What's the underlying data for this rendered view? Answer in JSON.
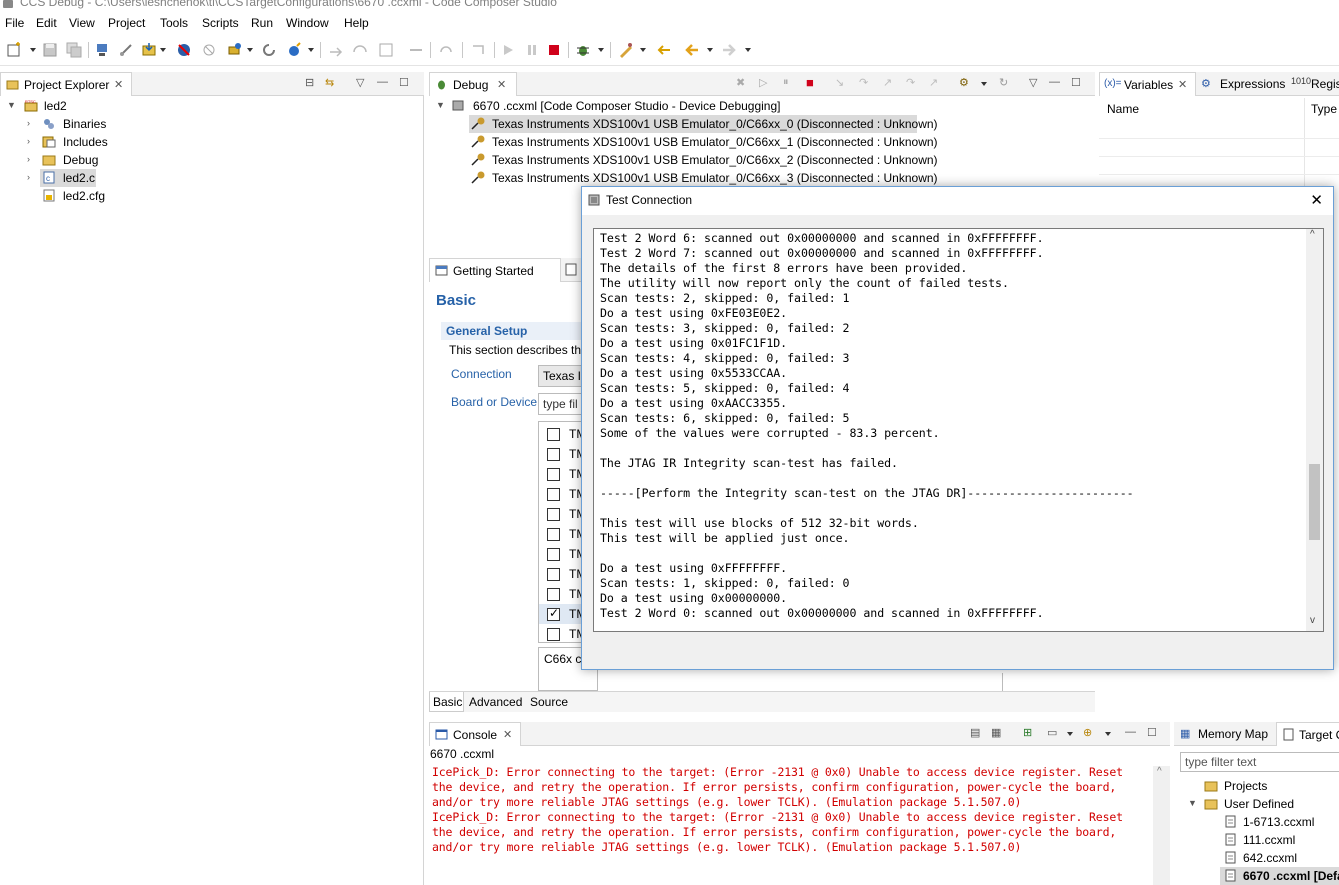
{
  "window": {
    "title": "CCS Debug - C:\\Users\\leshchenok\\ti\\CCSTargetConfigurations\\6670 .ccxml - Code Composer Studio"
  },
  "menu": [
    "File",
    "Edit",
    "View",
    "Project",
    "Tools",
    "Scripts",
    "Run",
    "Window",
    "Help"
  ],
  "project_explorer": {
    "tab_label": "Project Explorer",
    "project": "led2",
    "items": [
      "Binaries",
      "Includes",
      "Debug",
      "led2.c",
      "led2.cfg"
    ]
  },
  "debug_view": {
    "tab_label": "Debug",
    "session": "6670 .ccxml [Code Composer Studio - Device Debugging]",
    "cores": [
      "Texas Instruments XDS100v1 USB Emulator_0/C66xx_0 (Disconnected : Unknown)",
      "Texas Instruments XDS100v1 USB Emulator_0/C66xx_1 (Disconnected : Unknown)",
      "Texas Instruments XDS100v1 USB Emulator_0/C66xx_2 (Disconnected : Unknown)",
      "Texas Instruments XDS100v1 USB Emulator_0/C66xx_3 (Disconnected : Unknown)"
    ]
  },
  "variables_view": {
    "tabs": [
      "Variables",
      "Expressions",
      "Regist"
    ],
    "columns": [
      "Name",
      "Type"
    ]
  },
  "getting_started": {
    "tab_label": "Getting Started",
    "heading": "Basic",
    "section_title": "General Setup",
    "section_desc": "This section describes the",
    "connection_label": "Connection",
    "connection_value": "Texas In",
    "board_label": "Board or Device",
    "filter_placeholder": "type fil",
    "devices": [
      "TM",
      "TM",
      "TM",
      "TM",
      "TM",
      "TM",
      "TM",
      "TM",
      "TM",
      "TM",
      "TM"
    ],
    "checked_index": 9,
    "description_box": "C66x co",
    "bottom_tabs": [
      "Basic",
      "Advanced",
      "Source"
    ]
  },
  "console": {
    "tab_label": "Console",
    "config_name": "6670 .ccxml",
    "lines": [
      "IcePick_D: Error connecting to the target: (Error -2131 @ 0x0) Unable to access device register. Reset",
      "the device, and retry the operation. If error persists, confirm configuration, power-cycle the board,",
      "and/or try more reliable JTAG settings (e.g. lower TCLK). (Emulation package 5.1.507.0)",
      "IcePick_D: Error connecting to the target: (Error -2131 @ 0x0) Unable to access device register. Reset",
      "the device, and retry the operation. If error persists, confirm configuration, power-cycle the board,",
      "and/or try more reliable JTAG settings (e.g. lower TCLK). (Emulation package 5.1.507.0)"
    ]
  },
  "target_configs": {
    "tabs": [
      "Memory Map",
      "Target C"
    ],
    "filter_placeholder": "type filter text",
    "nodes": [
      "Projects",
      "User Defined"
    ],
    "files": [
      "1-6713.ccxml",
      "111.ccxml",
      "642.ccxml",
      "6670 .ccxml [Defa"
    ]
  },
  "dialog": {
    "title": "Test Connection",
    "close_label": "✕",
    "lines": [
      "Test 2 Word 6: scanned out 0x00000000 and scanned in 0xFFFFFFFF.",
      "Test 2 Word 7: scanned out 0x00000000 and scanned in 0xFFFFFFFF.",
      "The details of the first 8 errors have been provided.",
      "The utility will now report only the count of failed tests.",
      "Scan tests: 2, skipped: 0, failed: 1",
      "Do a test using 0xFE03E0E2.",
      "Scan tests: 3, skipped: 0, failed: 2",
      "Do a test using 0x01FC1F1D.",
      "Scan tests: 4, skipped: 0, failed: 3",
      "Do a test using 0x5533CCAA.",
      "Scan tests: 5, skipped: 0, failed: 4",
      "Do a test using 0xAACC3355.",
      "Scan tests: 6, skipped: 0, failed: 5",
      "Some of the values were corrupted - 83.3 percent.",
      "",
      "The JTAG IR Integrity scan-test has failed.",
      "",
      "-----[Perform the Integrity scan-test on the JTAG DR]------------------------",
      "",
      "This test will use blocks of 512 32-bit words.",
      "This test will be applied just once.",
      "",
      "Do a test using 0xFFFFFFFF.",
      "Scan tests: 1, skipped: 0, failed: 0",
      "Do a test using 0x00000000.",
      "Test 2 Word 0: scanned out 0x00000000 and scanned in 0xFFFFFFFF."
    ]
  },
  "colors": {
    "error_text": "#d10000",
    "link_blue": "#2762a8",
    "dialog_border": "#6a9fd6"
  }
}
